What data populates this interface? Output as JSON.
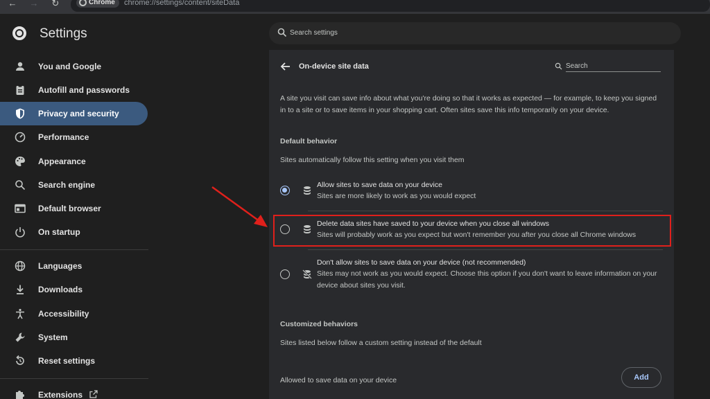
{
  "browser": {
    "chip_label": "Chrome",
    "url": "chrome://settings/content/siteData"
  },
  "header": {
    "title": "Settings",
    "search_placeholder": "Search settings"
  },
  "sidebar": {
    "items": [
      {
        "label": "You and Google",
        "icon": "person-icon"
      },
      {
        "label": "Autofill and passwords",
        "icon": "clipboard-icon"
      },
      {
        "label": "Privacy and security",
        "icon": "shield-icon",
        "active": true
      },
      {
        "label": "Performance",
        "icon": "gauge-icon"
      },
      {
        "label": "Appearance",
        "icon": "palette-icon"
      },
      {
        "label": "Search engine",
        "icon": "search-icon"
      },
      {
        "label": "Default browser",
        "icon": "browser-icon"
      },
      {
        "label": "On startup",
        "icon": "power-icon"
      },
      {
        "label": "Languages",
        "icon": "globe-icon"
      },
      {
        "label": "Downloads",
        "icon": "download-icon"
      },
      {
        "label": "Accessibility",
        "icon": "accessibility-icon"
      },
      {
        "label": "System",
        "icon": "wrench-icon"
      },
      {
        "label": "Reset settings",
        "icon": "reset-icon"
      },
      {
        "label": "Extensions",
        "icon": "puzzle-icon"
      }
    ]
  },
  "page": {
    "title": "On-device site data",
    "search_placeholder": "Search",
    "description": "A site you visit can save info about what you're doing so that it works as expected — for example, to keep you signed in to a site or to save items in your shopping cart. Often sites save this info temporarily on your device.",
    "default_behavior": {
      "heading": "Default behavior",
      "subheading": "Sites automatically follow this setting when you visit them",
      "options": [
        {
          "title": "Allow sites to save data on your device",
          "desc": "Sites are more likely to work as you would expect",
          "checked": true
        },
        {
          "title": "Delete data sites have saved to your device when you close all windows",
          "desc": "Sites will probably work as you expect but won't remember you after you close all Chrome windows",
          "checked": false
        },
        {
          "title": "Don't allow sites to save data on your device (not recommended)",
          "desc": "Sites may not work as you would expect. Choose this option if you don't want to leave information on your device about sites you visit.",
          "checked": false
        }
      ]
    },
    "customized": {
      "heading": "Customized behaviors",
      "subheading": "Sites listed below follow a custom setting instead of the default",
      "allowed_label": "Allowed to save data on your device",
      "add_label": "Add"
    }
  },
  "colors": {
    "highlight_box": "#e0201b",
    "annotation_arrow": "#e0201b",
    "active_nav": "#3b5a7f",
    "accent": "#a8c7fa"
  }
}
